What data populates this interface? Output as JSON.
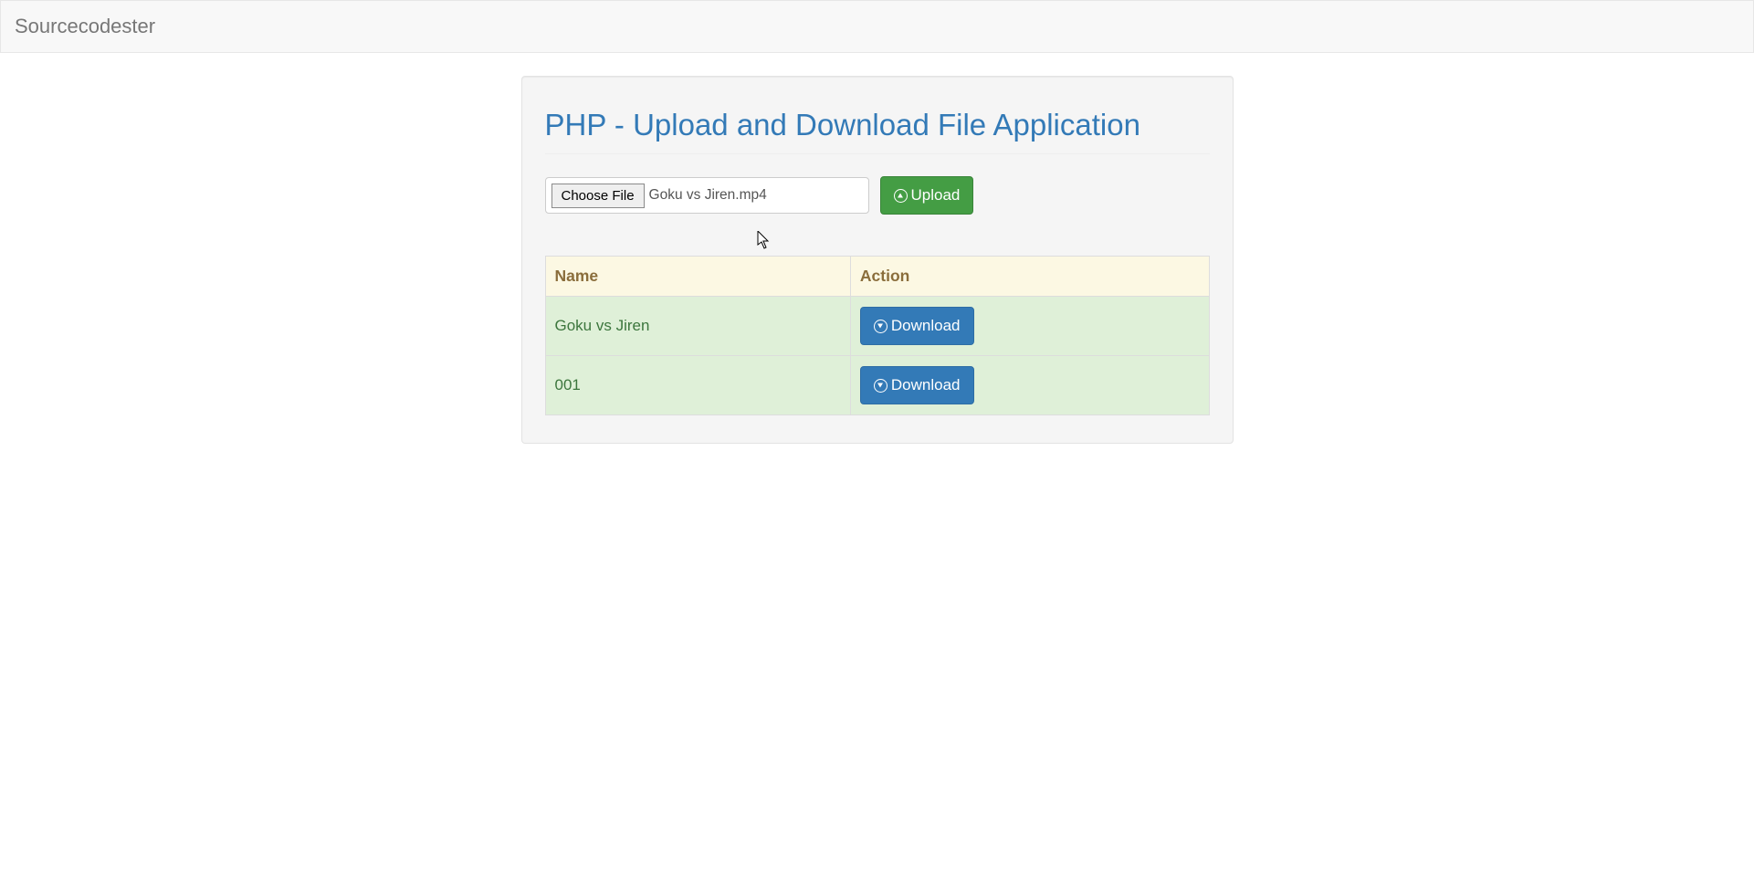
{
  "navbar": {
    "brand": "Sourcecodester"
  },
  "page": {
    "title": "PHP - Upload and Download File Application"
  },
  "upload": {
    "choose_label": "Choose File",
    "chosen_file": "Goku vs Jiren.mp4",
    "upload_button": "Upload"
  },
  "table": {
    "headers": {
      "name": "Name",
      "action": "Action"
    },
    "download_label": "Download",
    "rows": [
      {
        "name": "Goku vs Jiren"
      },
      {
        "name": "001"
      }
    ]
  }
}
